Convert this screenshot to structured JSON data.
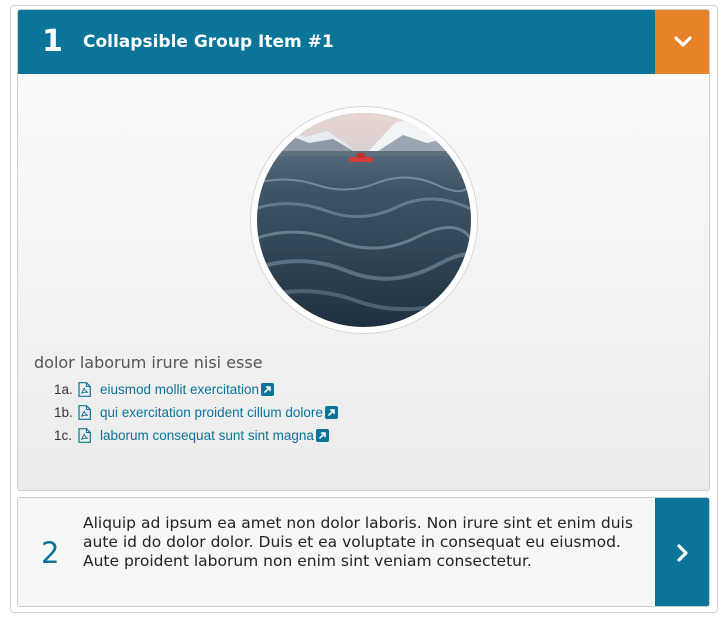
{
  "accordion": {
    "item1": {
      "number": "1",
      "title": "Collapsible Group Item #1",
      "toggle_icon": "chevron-down-icon",
      "image_alt": "Dark ocean waves with a small red boat near snowy mountains",
      "section_heading": "dolor laborum irure nisi esse",
      "documents": [
        {
          "number": "1a.",
          "label": "eiusmod mollit exercitation",
          "type_icon": "pdf-file-icon",
          "link_icon": "external-link-icon"
        },
        {
          "number": "1b.",
          "label": "qui exercitation proident cillum dolore",
          "type_icon": "pdf-file-icon",
          "link_icon": "external-link-icon"
        },
        {
          "number": "1c.",
          "label": "laborum consequat sunt sint magna",
          "type_icon": "pdf-file-icon",
          "link_icon": "external-link-icon"
        }
      ]
    },
    "item2": {
      "number": "2",
      "text": "Aliquip ad ipsum ea amet non dolor laboris. Non irure sint et enim duis aute id do dolor dolor. Duis et ea voluptate in consequat eu eiusmod. Aute proident laborum non enim sint veniam consectetur.",
      "toggle_icon": "chevron-right-icon"
    }
  },
  "colors": {
    "header_blue": "#0a7499",
    "toggle_orange": "#e8822a",
    "link": "#0a7499"
  }
}
